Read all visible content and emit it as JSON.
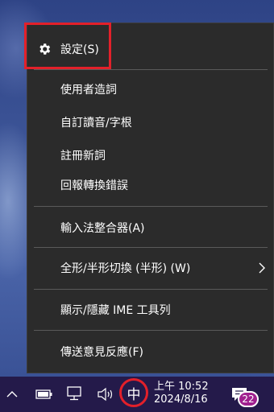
{
  "menu": {
    "items": [
      {
        "label": "設定(S)",
        "icon": "gear-icon"
      },
      {
        "label": "使用者造詞"
      },
      {
        "label": "自訂讀音/字根"
      },
      {
        "label": "註冊新詞"
      },
      {
        "label": "回報轉換錯誤"
      },
      {
        "label": "輸入法整合器(A)"
      },
      {
        "label": "全形/半形切換 (半形) (W)",
        "submenu": "chevron-right-icon"
      },
      {
        "label": "顯示/隱藏 IME  工具列"
      },
      {
        "label": "傳送意見反應(F)"
      }
    ]
  },
  "taskbar": {
    "ime_indicator": "中",
    "time": "上午 10:52",
    "date": "2024/8/16",
    "notification_count": "22",
    "icons": [
      "chevron-up-icon",
      "battery-icon",
      "network-icon",
      "volume-icon",
      "notification-icon"
    ]
  },
  "colors": {
    "menu_bg": "#2b2b2b",
    "highlight": "#e3202a",
    "taskbar_bg": "#241a4a",
    "badge": "#a0208f"
  }
}
